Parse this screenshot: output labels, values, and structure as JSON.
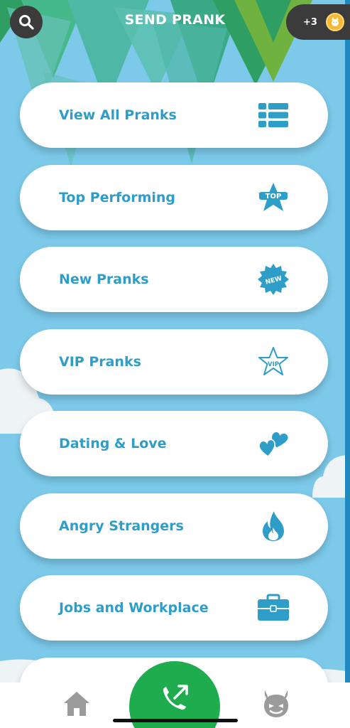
{
  "header": {
    "title": "SEND PRANK",
    "coins_label": "+3"
  },
  "icons": {
    "search": "search-icon",
    "coin": "coin-icon",
    "home": "home-icon",
    "call": "call-transfer-icon",
    "devil": "devil-icon"
  },
  "menu": {
    "items": [
      {
        "label": "View All Pranks",
        "icon": "list-icon"
      },
      {
        "label": "Top Performing",
        "icon": "top-star-icon"
      },
      {
        "label": "New Pranks",
        "icon": "new-badge-icon"
      },
      {
        "label": "VIP Pranks",
        "icon": "vip-star-icon"
      },
      {
        "label": "Dating & Love",
        "icon": "hearts-icon"
      },
      {
        "label": "Angry Strangers",
        "icon": "flame-icon"
      },
      {
        "label": "Jobs and Workplace",
        "icon": "briefcase-icon"
      }
    ]
  },
  "colors": {
    "accent": "#2e9ec9",
    "sky": "#7cc9ea",
    "call_green": "#1fac4e",
    "dark_chip": "#3b3b3b"
  }
}
